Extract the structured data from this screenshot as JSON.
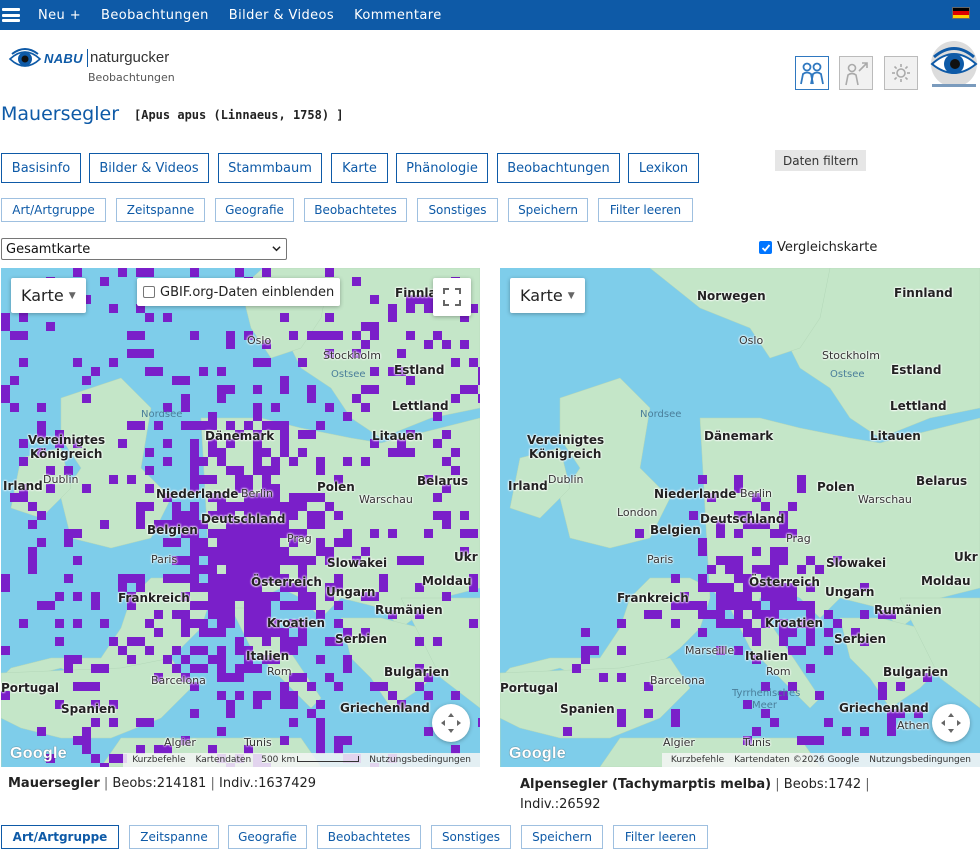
{
  "nav": {
    "items": [
      "Neu +",
      "Beobachtungen",
      "Bilder & Videos",
      "Kommentare"
    ]
  },
  "logo": {
    "brand": "NABU",
    "product": "naturgucker",
    "subtitle": "Beobachtungen"
  },
  "header_icons": [
    "people-icon",
    "person-arrow-icon",
    "settings-icon"
  ],
  "species": {
    "name": "Mauersegler",
    "scientific": "[Apus apus (Linnaeus, 1758) ]"
  },
  "tabs": [
    "Basisinfo",
    "Bilder & Videos",
    "Stammbaum",
    "Karte",
    "Phänologie",
    "Beobachtungen",
    "Lexikon"
  ],
  "filter_toggle": "Daten filtern",
  "filters_top": [
    "Art/Artgruppe",
    "Zeitspanne",
    "Geografie",
    "Beobachtetes",
    "Sonstiges",
    "Speichern",
    "Filter leeren"
  ],
  "filters_bottom": [
    "Art/Artgruppe",
    "Zeitspanne",
    "Geografie",
    "Beobachtetes",
    "Sonstiges",
    "Speichern",
    "Filter leeren"
  ],
  "map_select": {
    "value": "Gesamtkarte"
  },
  "compare": {
    "label": "Vergleichskarte",
    "checked": true
  },
  "map_common": {
    "type_label": "Karte",
    "gbif_label": "GBIF.org-Daten einblenden",
    "google": "Google",
    "attr_shortcuts": "Kurzbefehle",
    "attr_data": "Kartendaten",
    "attr_data_full": "Kartendaten ©2026 Google",
    "attr_scale": "500 km",
    "attr_terms": "Nutzungsbedingungen"
  },
  "map_labels": {
    "norwegen": "Norwegen",
    "finnland": "Finnland",
    "oslo": "Oslo",
    "stockholm": "Stockholm",
    "ostsee": "Ostsee",
    "estland": "Estland",
    "nordsee": "Nordsee",
    "lettland": "Lettland",
    "daenemark": "Dänemark",
    "litauen": "Litauen",
    "vk1": "Vereinigtes",
    "vk2": "Königreich",
    "irland": "Irland",
    "dublin": "Dublin",
    "belarus": "Belarus",
    "niederlande": "Niederlande",
    "berlin": "Berlin",
    "polen": "Polen",
    "warschau": "Warschau",
    "london": "London",
    "belgien": "Belgien",
    "deutschland": "Deutschland",
    "prag": "Prag",
    "ukr": "Ukr",
    "paris": "Paris",
    "slowakei": "Slowakei",
    "moldau": "Moldau",
    "oesterreich": "Österreich",
    "frankreich": "Frankreich",
    "ungarn": "Ungarn",
    "rumaenien": "Rumänien",
    "kroatien": "Kroatien",
    "serbien": "Serbien",
    "marseille": "Marseille",
    "italien": "Italien",
    "bulgarien": "Bulgarien",
    "portugal": "Portugal",
    "barcelona": "Barcelona",
    "rom": "Rom",
    "tyrrh1": "Tyrrhenisches",
    "tyrrh2": "Meer",
    "spanien": "Spanien",
    "griechenland": "Griechenland",
    "athen": "Athen",
    "algier": "Algier",
    "tunis": "Tunis"
  },
  "captions": {
    "left": {
      "name": "Mauersegler",
      "beobs": "Beobs:214181",
      "indiv": "Indiv.:1637429"
    },
    "right": {
      "name": "Alpensegler (Tachymarptis melba)",
      "beobs": "Beobs:1742",
      "indiv": "Indiv.:26592"
    }
  },
  "colors": {
    "navbar": "#0e5aa7",
    "accent": "#0e5aa7",
    "observation": "#7a1fc9",
    "sea": "#7ecdea",
    "land": "#bfe3c6"
  }
}
